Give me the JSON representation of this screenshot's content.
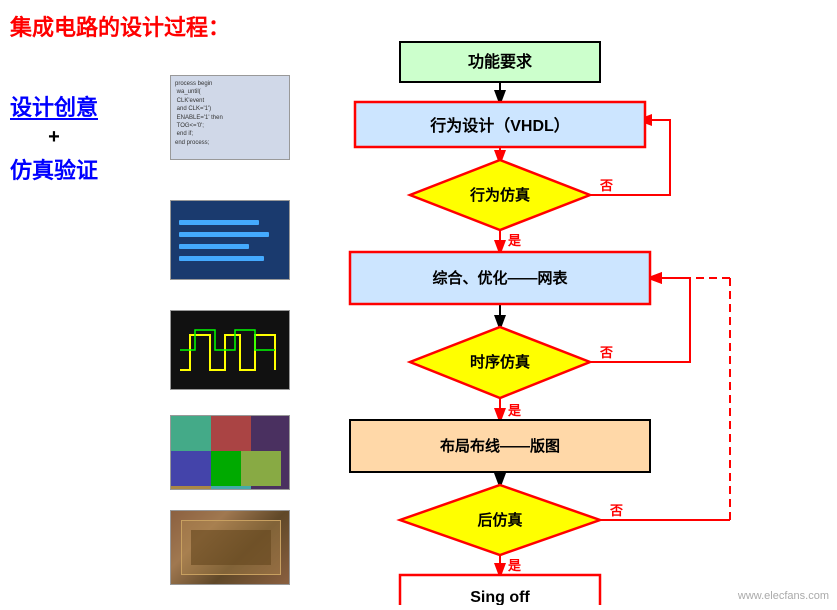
{
  "title": {
    "main": "集成电路的设计过程：",
    "colon_colored": ""
  },
  "left_labels": {
    "design": "设计创意",
    "plus": "+",
    "sim": "仿真验证"
  },
  "flowchart": {
    "boxes": {
      "func_req": "功能要求",
      "behavior_design": "行为设计（VHDL）",
      "behavior_sim": "行为仿真",
      "synthesis": "综合、优化——网表",
      "timing_sim": "时序仿真",
      "layout": "布局布线——版图",
      "post_sim": "后仿真",
      "sign_off": "Sing off"
    },
    "arrow_labels": {
      "yes1": "是",
      "no1": "否",
      "yes2": "是",
      "no2": "否",
      "yes3": "是",
      "no3": "否"
    }
  },
  "thumb_code": "process begin\n  wa_until(\n  CLK'event\n  and CLK='1')\n  ENABLE='1' then\n  TOG<='0';\n  end if;\nend process;",
  "watermark": "www.elecfans.com"
}
